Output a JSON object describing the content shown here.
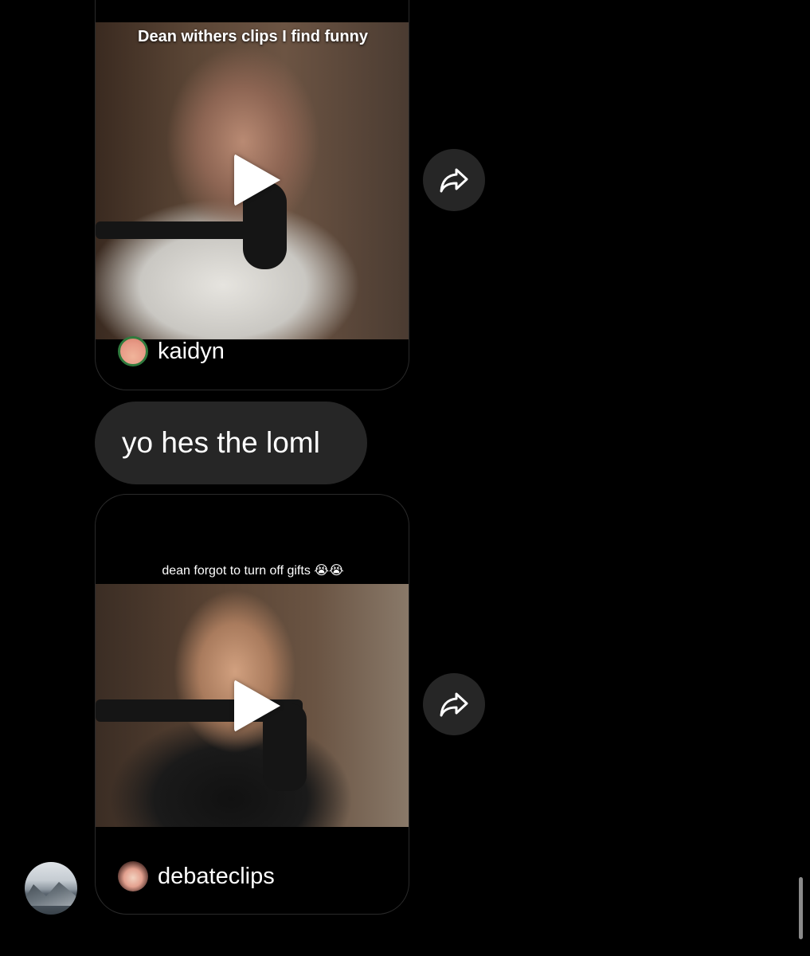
{
  "messages": [
    {
      "type": "shared_post",
      "caption": "Dean withers clips I find funny",
      "author": "kaidyn"
    },
    {
      "type": "text",
      "text": "yo hes the loml"
    },
    {
      "type": "shared_post",
      "caption": "dean forgot to turn off gifts 😭😭",
      "author": "debateclips"
    }
  ],
  "icons": {
    "share": "share-arrow-icon",
    "play": "play-icon"
  },
  "colors": {
    "background": "#000000",
    "bubble": "#262626",
    "text": "#ffffff"
  }
}
